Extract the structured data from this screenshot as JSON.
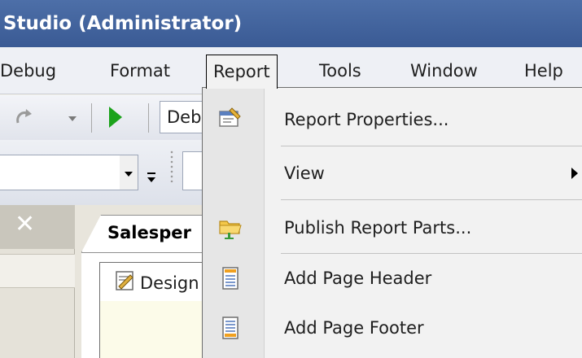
{
  "window": {
    "title": "Studio (Administrator)"
  },
  "menubar": {
    "items": [
      {
        "label": "Debug"
      },
      {
        "label": "Format"
      },
      {
        "label": "Report",
        "active": true
      },
      {
        "label": "Tools"
      },
      {
        "label": "Window"
      },
      {
        "label": "Help"
      }
    ]
  },
  "toolbar": {
    "redo_icon": "redo-icon",
    "start_icon": "play-icon",
    "config_value": "Deb"
  },
  "left_panel": {
    "close_icon": "close-icon"
  },
  "document": {
    "tab_label": "Salesper",
    "design_tab_label": "Design",
    "design_icon": "design-icon"
  },
  "report_menu": {
    "items": [
      {
        "label": "Report Properties...",
        "icon": "report-properties-icon"
      },
      {
        "label": "View",
        "icon": "",
        "has_submenu": true
      },
      {
        "label": "Publish Report Parts...",
        "icon": "publish-icon"
      },
      {
        "label": "Add Page Header",
        "icon": "page-header-icon"
      },
      {
        "label": "Add Page Footer",
        "icon": "page-footer-icon"
      }
    ]
  },
  "colors": {
    "titlebar": "#3a5a94",
    "menu_background": "#f2f2f2",
    "play_green": "#1ba21b"
  }
}
